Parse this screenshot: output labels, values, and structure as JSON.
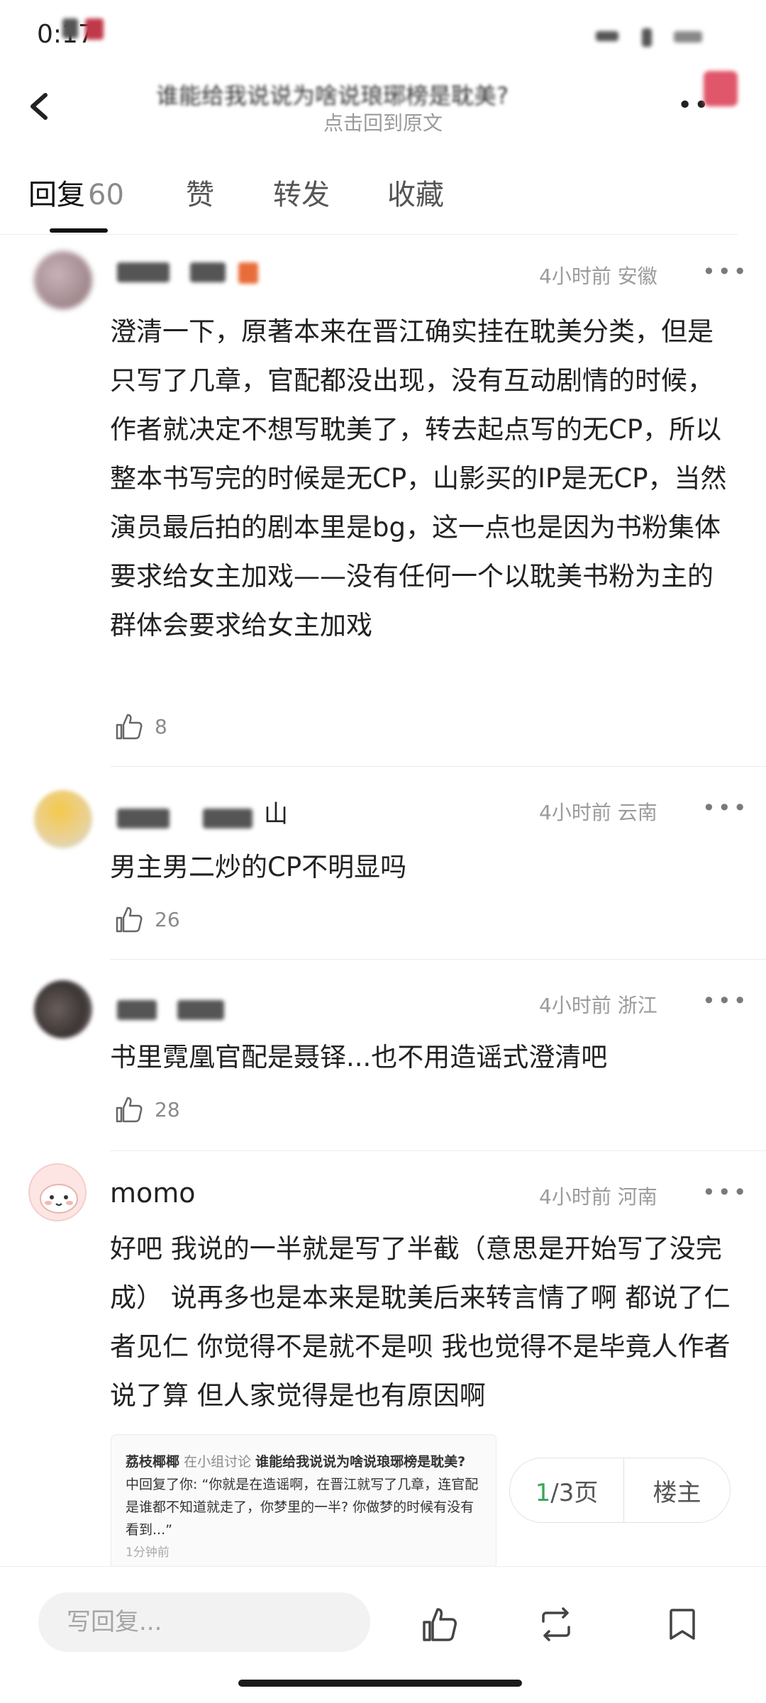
{
  "status": {
    "time": "0:17"
  },
  "header": {
    "title": "谁能给我说说为啥说琅琊榜是耽美?",
    "subtitle": "点击回到原文"
  },
  "tabs": [
    {
      "label": "回复",
      "count": "60"
    },
    {
      "label": "赞"
    },
    {
      "label": "转发"
    },
    {
      "label": "收藏"
    }
  ],
  "comments": [
    {
      "username": "",
      "username_suffix": "",
      "time": "4小时前",
      "location": "安徽",
      "text": "澄清一下，原著本来在晋江确实挂在耽美分类，但是只写了几章，官配都没出现，没有互动剧情的时候，作者就决定不想写耽美了，转去起点写的无CP，所以整本书写完的时候是无CP，山影买的IP是无CP，当然演员最后拍的剧本里是bg，这一点也是因为书粉集体要求给女主加戏——没有任何一个以耽美书粉为主的群体会要求给女主加戏",
      "likes": "8"
    },
    {
      "username": "",
      "username_suffix": "山",
      "time": "4小时前",
      "location": "云南",
      "text": "男主男二炒的CP不明显吗",
      "likes": "26"
    },
    {
      "username": "",
      "username_suffix": "",
      "time": "4小时前",
      "location": "浙江",
      "text": "书里霓凰官配是聂铎...也不用造谣式澄清吧",
      "likes": "28"
    },
    {
      "username": "momo",
      "username_suffix": "",
      "time": "4小时前",
      "location": "河南",
      "text": "好吧 我说的一半就是写了半截（意思是开始写了没完成） 说再多也是本来是耽美后来转言情了啊 都说了仁者见仁 你觉得不是就不是呗 我也觉得不是毕竟人作者说了算 但人家觉得是也有原因啊",
      "likes": ""
    }
  ],
  "quote": {
    "name": "荔枝椰椰",
    "group_prefix": "在小组讨论",
    "title": "谁能给我说说为啥说琅琊榜是耽美?",
    "body": "中回复了你: “你就是在造谣啊，在晋江就写了几章，连官配是谁都不知道就走了，你梦里的一半? 你做梦的时候有没有看到...”",
    "time": "1分钟前"
  },
  "pagination": {
    "current": "1",
    "total_suffix": "/3页",
    "owner_label": "楼主"
  },
  "bottom": {
    "reply_placeholder": "写回复..."
  },
  "icons": [
    "back-icon",
    "more-icon",
    "thumbs-up-icon",
    "repost-icon",
    "bookmark-icon"
  ],
  "colors": {
    "accent_green": "#3aa55a",
    "text": "#222222",
    "muted": "#9b9b9b"
  }
}
